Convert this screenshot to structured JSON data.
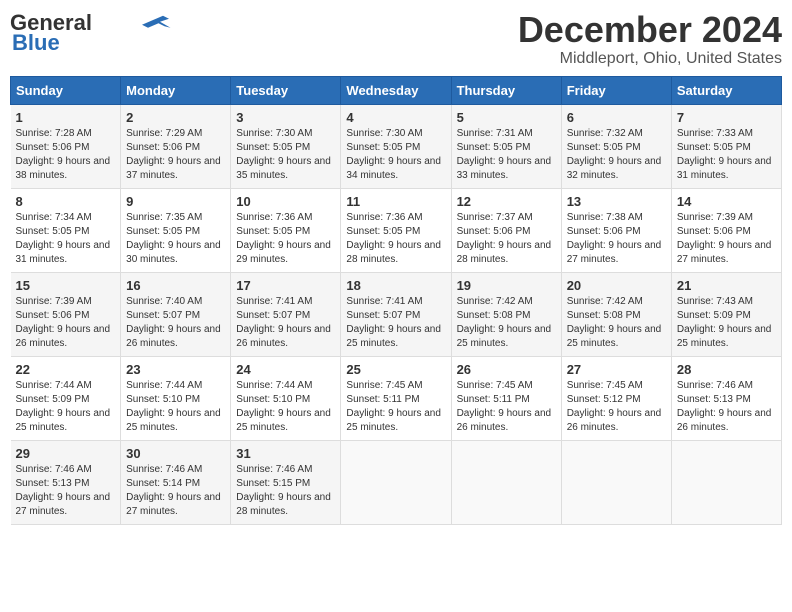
{
  "logo": {
    "line1": "General",
    "line2": "Blue",
    "plane_symbol": "✈"
  },
  "title": "December 2024",
  "location": "Middleport, Ohio, United States",
  "days_of_week": [
    "Sunday",
    "Monday",
    "Tuesday",
    "Wednesday",
    "Thursday",
    "Friday",
    "Saturday"
  ],
  "weeks": [
    [
      {
        "day": 1,
        "sunrise": "7:28 AM",
        "sunset": "5:06 PM",
        "daylight": "9 hours and 38 minutes."
      },
      {
        "day": 2,
        "sunrise": "7:29 AM",
        "sunset": "5:06 PM",
        "daylight": "9 hours and 37 minutes."
      },
      {
        "day": 3,
        "sunrise": "7:30 AM",
        "sunset": "5:05 PM",
        "daylight": "9 hours and 35 minutes."
      },
      {
        "day": 4,
        "sunrise": "7:30 AM",
        "sunset": "5:05 PM",
        "daylight": "9 hours and 34 minutes."
      },
      {
        "day": 5,
        "sunrise": "7:31 AM",
        "sunset": "5:05 PM",
        "daylight": "9 hours and 33 minutes."
      },
      {
        "day": 6,
        "sunrise": "7:32 AM",
        "sunset": "5:05 PM",
        "daylight": "9 hours and 32 minutes."
      },
      {
        "day": 7,
        "sunrise": "7:33 AM",
        "sunset": "5:05 PM",
        "daylight": "9 hours and 31 minutes."
      }
    ],
    [
      {
        "day": 8,
        "sunrise": "7:34 AM",
        "sunset": "5:05 PM",
        "daylight": "9 hours and 31 minutes."
      },
      {
        "day": 9,
        "sunrise": "7:35 AM",
        "sunset": "5:05 PM",
        "daylight": "9 hours and 30 minutes."
      },
      {
        "day": 10,
        "sunrise": "7:36 AM",
        "sunset": "5:05 PM",
        "daylight": "9 hours and 29 minutes."
      },
      {
        "day": 11,
        "sunrise": "7:36 AM",
        "sunset": "5:05 PM",
        "daylight": "9 hours and 28 minutes."
      },
      {
        "day": 12,
        "sunrise": "7:37 AM",
        "sunset": "5:06 PM",
        "daylight": "9 hours and 28 minutes."
      },
      {
        "day": 13,
        "sunrise": "7:38 AM",
        "sunset": "5:06 PM",
        "daylight": "9 hours and 27 minutes."
      },
      {
        "day": 14,
        "sunrise": "7:39 AM",
        "sunset": "5:06 PM",
        "daylight": "9 hours and 27 minutes."
      }
    ],
    [
      {
        "day": 15,
        "sunrise": "7:39 AM",
        "sunset": "5:06 PM",
        "daylight": "9 hours and 26 minutes."
      },
      {
        "day": 16,
        "sunrise": "7:40 AM",
        "sunset": "5:07 PM",
        "daylight": "9 hours and 26 minutes."
      },
      {
        "day": 17,
        "sunrise": "7:41 AM",
        "sunset": "5:07 PM",
        "daylight": "9 hours and 26 minutes."
      },
      {
        "day": 18,
        "sunrise": "7:41 AM",
        "sunset": "5:07 PM",
        "daylight": "9 hours and 25 minutes."
      },
      {
        "day": 19,
        "sunrise": "7:42 AM",
        "sunset": "5:08 PM",
        "daylight": "9 hours and 25 minutes."
      },
      {
        "day": 20,
        "sunrise": "7:42 AM",
        "sunset": "5:08 PM",
        "daylight": "9 hours and 25 minutes."
      },
      {
        "day": 21,
        "sunrise": "7:43 AM",
        "sunset": "5:09 PM",
        "daylight": "9 hours and 25 minutes."
      }
    ],
    [
      {
        "day": 22,
        "sunrise": "7:44 AM",
        "sunset": "5:09 PM",
        "daylight": "9 hours and 25 minutes."
      },
      {
        "day": 23,
        "sunrise": "7:44 AM",
        "sunset": "5:10 PM",
        "daylight": "9 hours and 25 minutes."
      },
      {
        "day": 24,
        "sunrise": "7:44 AM",
        "sunset": "5:10 PM",
        "daylight": "9 hours and 25 minutes."
      },
      {
        "day": 25,
        "sunrise": "7:45 AM",
        "sunset": "5:11 PM",
        "daylight": "9 hours and 25 minutes."
      },
      {
        "day": 26,
        "sunrise": "7:45 AM",
        "sunset": "5:11 PM",
        "daylight": "9 hours and 26 minutes."
      },
      {
        "day": 27,
        "sunrise": "7:45 AM",
        "sunset": "5:12 PM",
        "daylight": "9 hours and 26 minutes."
      },
      {
        "day": 28,
        "sunrise": "7:46 AM",
        "sunset": "5:13 PM",
        "daylight": "9 hours and 26 minutes."
      }
    ],
    [
      {
        "day": 29,
        "sunrise": "7:46 AM",
        "sunset": "5:13 PM",
        "daylight": "9 hours and 27 minutes."
      },
      {
        "day": 30,
        "sunrise": "7:46 AM",
        "sunset": "5:14 PM",
        "daylight": "9 hours and 27 minutes."
      },
      {
        "day": 31,
        "sunrise": "7:46 AM",
        "sunset": "5:15 PM",
        "daylight": "9 hours and 28 minutes."
      },
      null,
      null,
      null,
      null
    ]
  ]
}
